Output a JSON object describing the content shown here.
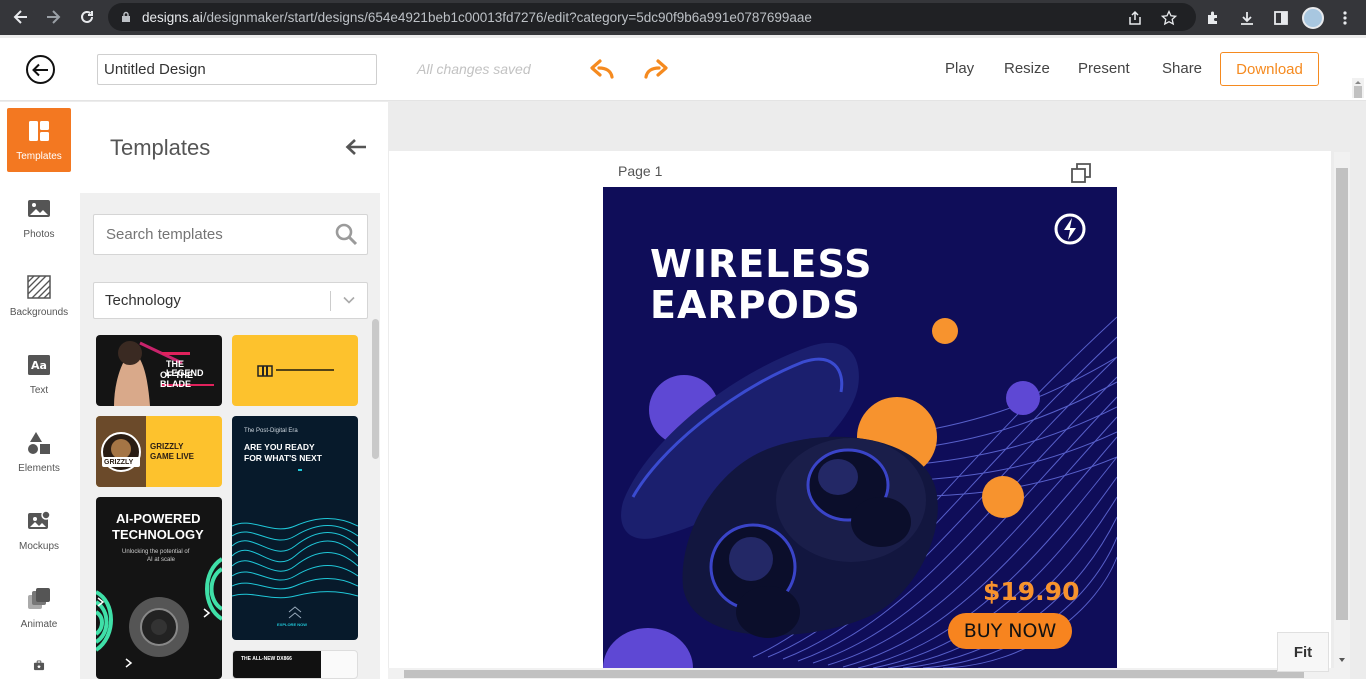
{
  "browser": {
    "url_host": "designs.ai",
    "url_path": "/designmaker/start/designs/654e4921beb1c00013fd7276/edit?category=5dc90f9b6a991e0787699aae"
  },
  "header": {
    "title_value": "Untitled Design",
    "save_status": "All changes saved",
    "links": {
      "play": "Play",
      "resize": "Resize",
      "present": "Present",
      "share": "Share"
    },
    "download_label": "Download",
    "accent_color": "#f58a1f"
  },
  "rail": {
    "items": [
      {
        "label": "Templates",
        "icon": "templates-icon",
        "active": true
      },
      {
        "label": "Photos",
        "icon": "photos-icon"
      },
      {
        "label": "Backgrounds",
        "icon": "backgrounds-icon"
      },
      {
        "label": "Text",
        "icon": "text-icon"
      },
      {
        "label": "Elements",
        "icon": "elements-icon"
      },
      {
        "label": "Mockups",
        "icon": "mockups-icon"
      },
      {
        "label": "Animate",
        "icon": "animate-icon"
      }
    ]
  },
  "panel": {
    "title": "Templates",
    "search_placeholder": "Search templates",
    "category_value": "Technology",
    "thumbs": {
      "t1": {
        "line1": "THE LEGEND",
        "line2": "OF THE BLADE"
      },
      "t3": {
        "badge": "GRIZZLY",
        "line1": "GRIZZLY",
        "line2": "GAME LIVE"
      },
      "t4": {
        "kicker": "The Post-Digital Era",
        "line1": "ARE YOU READY",
        "line2": "FOR WHAT'S NEXT",
        "cta": "EXPLORE NOW"
      },
      "t5": {
        "line1": "AI-POWERED",
        "line2": "TECHNOLOGY",
        "sub1": "Unlocking the potential of",
        "sub2": "AI at scale"
      },
      "t6": {
        "line1": "THE ALL-NEW DX866"
      }
    }
  },
  "canvas": {
    "page_label": "Page 1",
    "design": {
      "title1": "WIRELESS",
      "title2": "EARPODS",
      "price": "$19.90",
      "cta": "BUY NOW",
      "bg_color": "#0f0d59",
      "orange": "#f7932e",
      "purple": "#5e48d4"
    },
    "fit_label": "Fit"
  }
}
